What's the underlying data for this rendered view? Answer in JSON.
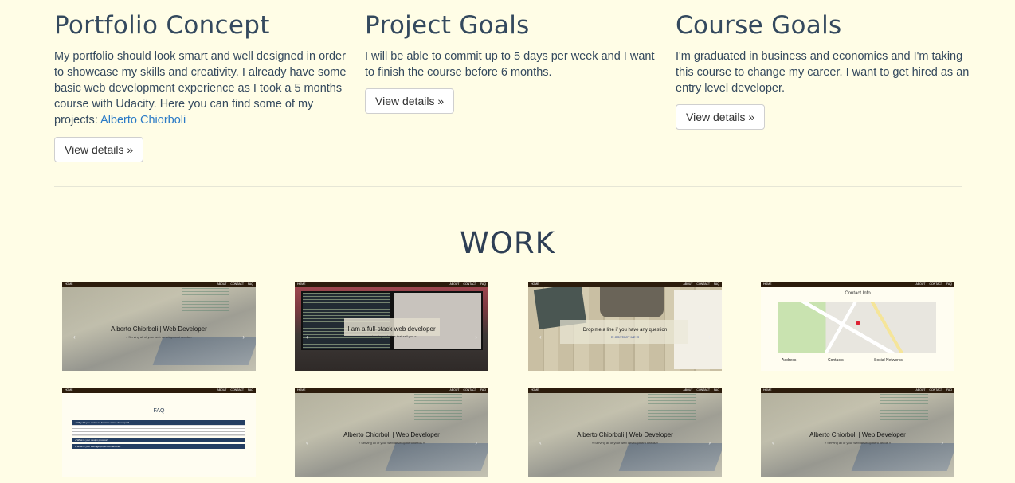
{
  "columns": [
    {
      "title": "Portfolio Concept",
      "text": "My portfolio should look smart and well designed in order to showcase my skills and creativity. I already have some basic web development experience as I took a 5 months course with Udacity. Here you can find some of my projects: ",
      "link_text": "Alberto Chiorboli",
      "button": "View details »"
    },
    {
      "title": "Project Goals",
      "text": "I will be able to commit up to 5 days per week and I want to finish the course before 6 months.",
      "button": "View details »"
    },
    {
      "title": "Course Goals",
      "text": "I'm graduated in business and economics and I'm taking this course to change my career. I want to get hired as an entry level developer.",
      "button": "View details »"
    }
  ],
  "work": {
    "title": "WORK",
    "nav": {
      "brand": "HOME",
      "links": "ABOUT CONTACT FAQ"
    },
    "thumbs": {
      "home_title": "Alberto Chiorboli | Web Developer",
      "home_sub": "« Serving all of your web development needs »",
      "about_title": "I am a full-stack web developer",
      "about_sub": "« I develop websites that sell you »",
      "contact_title": "Drop me a line if you have any question",
      "contact_sub": "✉ CONTACT ME ✉",
      "contact_info_title": "Contact Info",
      "contact_cols": [
        "Address",
        "Contacts",
        "Social Networks"
      ],
      "faq_title": "FAQ",
      "faq_q1": "» Why did you decide to become a web developer?",
      "faq_q2": "» What is your design process?",
      "faq_q3": "» What is your average project turnaround?"
    }
  },
  "colors": {
    "background": "#fffde6",
    "heading": "#34495e",
    "link": "#2a7ac6"
  }
}
